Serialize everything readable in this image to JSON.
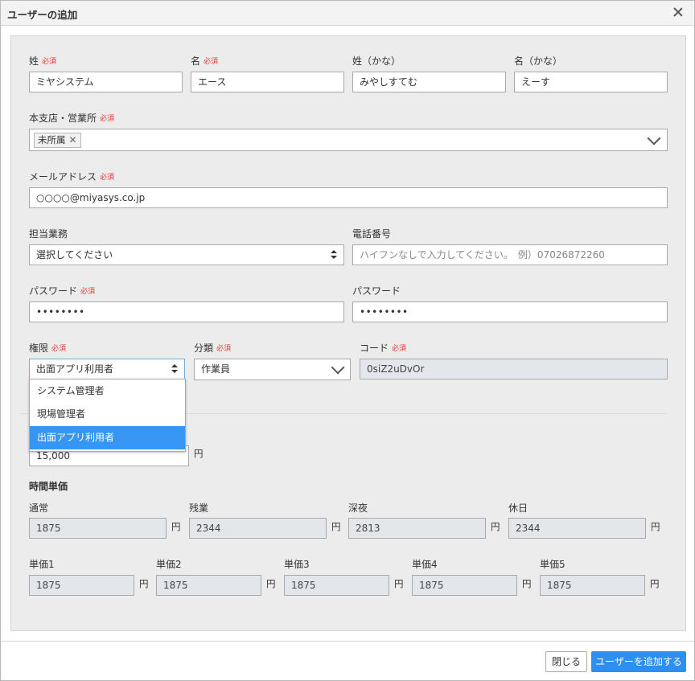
{
  "dialog": {
    "title": "ユーザーの追加"
  },
  "required_mark": "必須",
  "name": {
    "last_label": "姓",
    "last_value": "ミヤシステム",
    "first_label": "名",
    "first_value": "エース",
    "last_kana_label": "姓（かな）",
    "last_kana_value": "みやしすてむ",
    "first_kana_label": "名（かな）",
    "first_kana_value": "えーす"
  },
  "branch": {
    "label": "本支店・営業所",
    "selected_tag": "未所属"
  },
  "email": {
    "label": "メールアドレス",
    "value": "○○○○@miyasys.co.jp"
  },
  "duty": {
    "label": "担当業務",
    "value": "選択してください"
  },
  "phone": {
    "label": "電話番号",
    "placeholder": "ハイフンなしで入力してください。　例）07026872260"
  },
  "password": {
    "label": "パスワード",
    "value": "••••••••",
    "confirm_label": "パスワード",
    "confirm_value": "••••••••"
  },
  "role": {
    "label": "権限",
    "value": "出面アプリ利用者",
    "options": [
      "システム管理者",
      "現場管理者",
      "出面アプリ利用者"
    ],
    "selected_index": 2
  },
  "category": {
    "label": "分類",
    "value": "作業員"
  },
  "code": {
    "label": "コード",
    "value": "0siZ2uDvOr"
  },
  "daily": {
    "value": "15,000",
    "unit": "円"
  },
  "hourly": {
    "title": "時間単価",
    "unit": "円",
    "row1": [
      {
        "label": "通常",
        "value": "1875"
      },
      {
        "label": "残業",
        "value": "2344"
      },
      {
        "label": "深夜",
        "value": "2813"
      },
      {
        "label": "休日",
        "value": "2344"
      }
    ],
    "row2": [
      {
        "label": "単価1",
        "value": "1875"
      },
      {
        "label": "単価2",
        "value": "1875"
      },
      {
        "label": "単価3",
        "value": "1875"
      },
      {
        "label": "単価4",
        "value": "1875"
      },
      {
        "label": "単価5",
        "value": "1875"
      }
    ]
  },
  "footer": {
    "close_label": "閉じる",
    "add_label": "ユーザーを追加する"
  },
  "colors": {
    "primary": "#2d8fef",
    "required": "#e53935",
    "selected_option": "#3795f4"
  }
}
